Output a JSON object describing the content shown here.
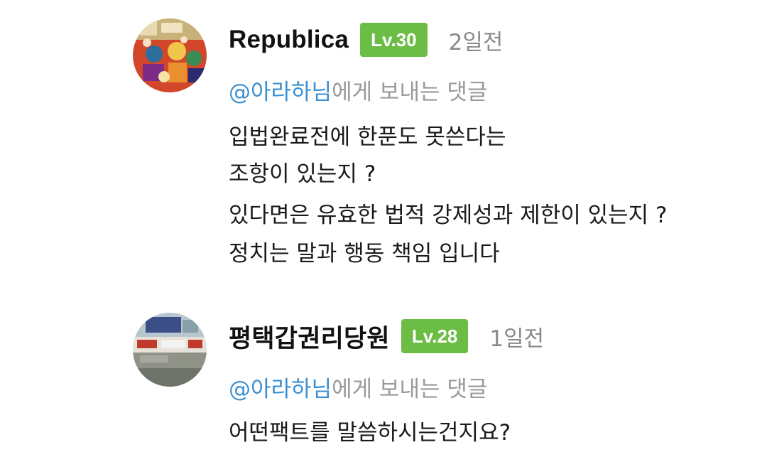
{
  "comments": [
    {
      "username": "Republica",
      "level": "Lv.30",
      "time": "2일전",
      "mention": "@아라하님",
      "reply_suffix": "에게 보내는 댓글",
      "lines": [
        "입법완료전에 한푼도 못쓴다는",
        "조항이 있는지 ?",
        "있다면은 유효한 법적 강제성과 제한이 있는지 ?",
        "정치는 말과 행동 책임 입니다"
      ]
    },
    {
      "username": "평택갑권리당원",
      "level": "Lv.28",
      "time": "1일전",
      "mention": "@아라하님",
      "reply_suffix": "에게 보내는 댓글",
      "lines": [
        "어떤팩트를 말씀하시는건지요?"
      ]
    }
  ],
  "colors": {
    "level_badge": "#6cbd45",
    "mention": "#3a8fd0",
    "meta_text": "#8a8a8a"
  }
}
